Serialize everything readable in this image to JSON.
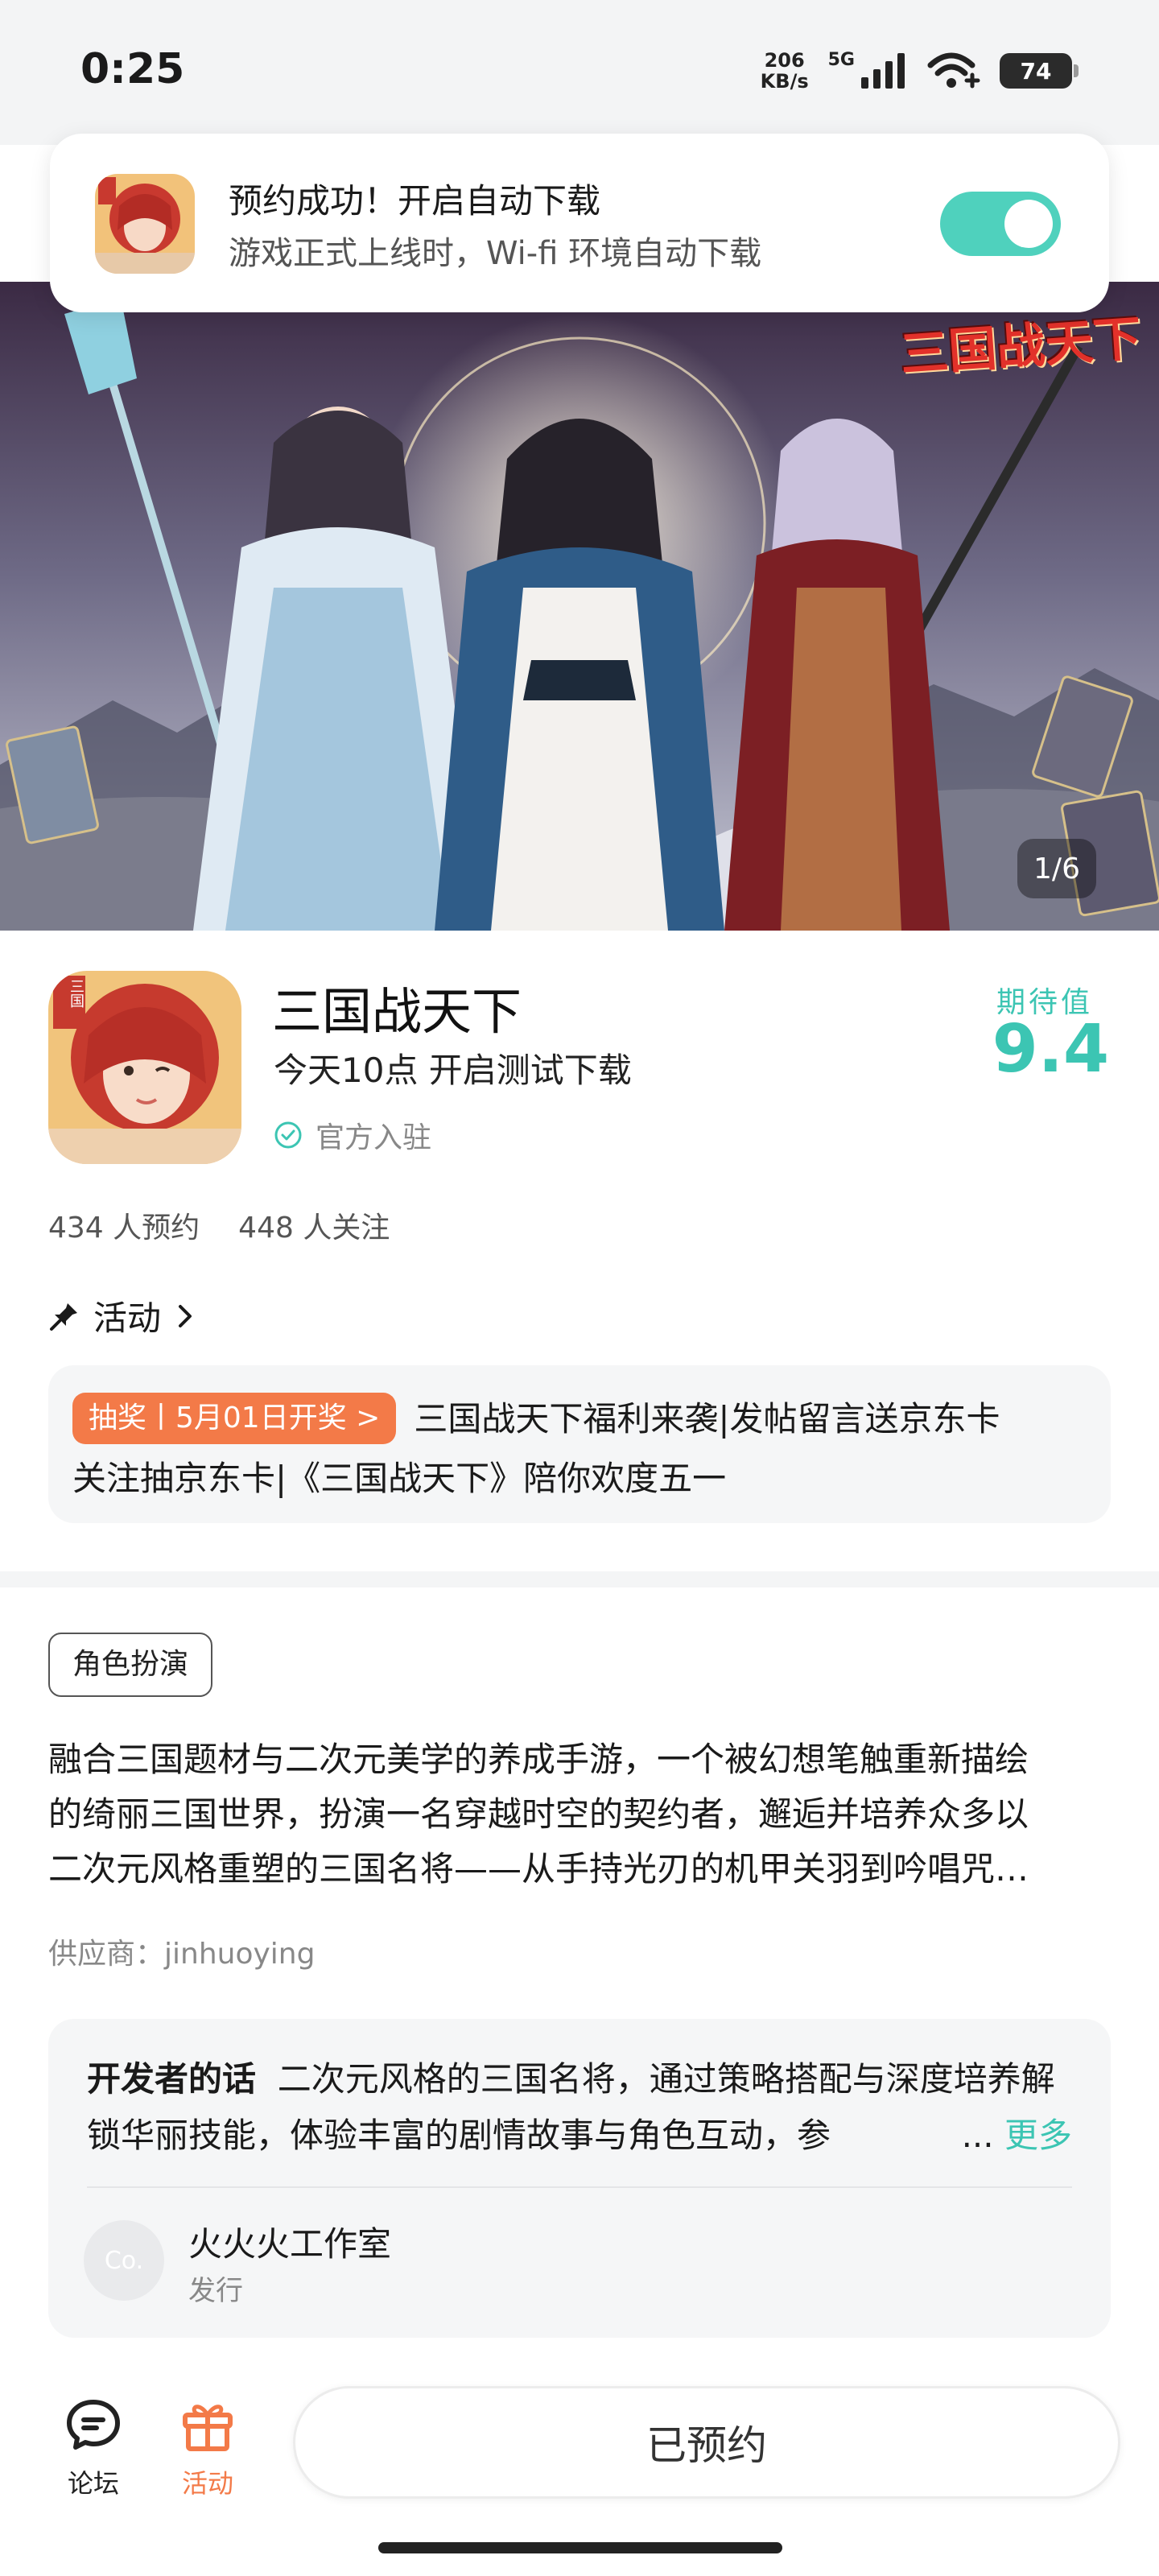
{
  "status_bar": {
    "time": "0:25",
    "net_speed_value": "206",
    "net_speed_unit": "KB/s",
    "network_type": "5G",
    "battery": "74"
  },
  "notification": {
    "title": "预约成功！开启自动下载",
    "subtitle": "游戏正式上线时，Wi-fi 环境自动下载",
    "toggle_on": true
  },
  "banner": {
    "pager": "1/6",
    "logo_text": "三国战天下"
  },
  "app": {
    "name": "三国战天下",
    "subtitle": "今天10点 开启测试下载",
    "official": "官方入驻",
    "expect_label": "期待值",
    "expect_value": "9.4",
    "icon_badge": "三国",
    "reservations": "434 人预约",
    "followers": "448 人关注"
  },
  "activity": {
    "section_title": "活动",
    "badge": "抽奖丨5月01日开奖 >",
    "line1": "三国战天下福利来袭|发帖留言送京东卡",
    "line2": "关注抽京东卡|《三国战天下》陪你欢度五一"
  },
  "tag": "角色扮演",
  "description": {
    "line1": "融合三国题材与二次元美学的养成手游，一个被幻想笔触重新描绘",
    "line2": "的绮丽三国世界，扮演一名穿越时空的契约者，邂逅并培养众多以",
    "line3": "二次元风格重塑的三国名将——从手持光刃的机甲关羽到吟唱咒…"
  },
  "supplier": "供应商：jinhuoying",
  "developer": {
    "label": "开发者的话",
    "text": "二次元风格的三国名将，通过策略搭配与深度培养解锁华丽技能，体验丰富的剧情故事与角色互动，参",
    "ellipsis": "...",
    "more": "更多",
    "studio_name": "火火火工作室",
    "studio_role": "发行",
    "studio_avatar": "Co."
  },
  "bottom_nav": {
    "forum": "论坛",
    "activity": "活动",
    "reserve_button": "已预约"
  },
  "colors": {
    "accent": "#3cc5b3",
    "toggle": "#4fd1bd",
    "badge": "#f37a48"
  }
}
